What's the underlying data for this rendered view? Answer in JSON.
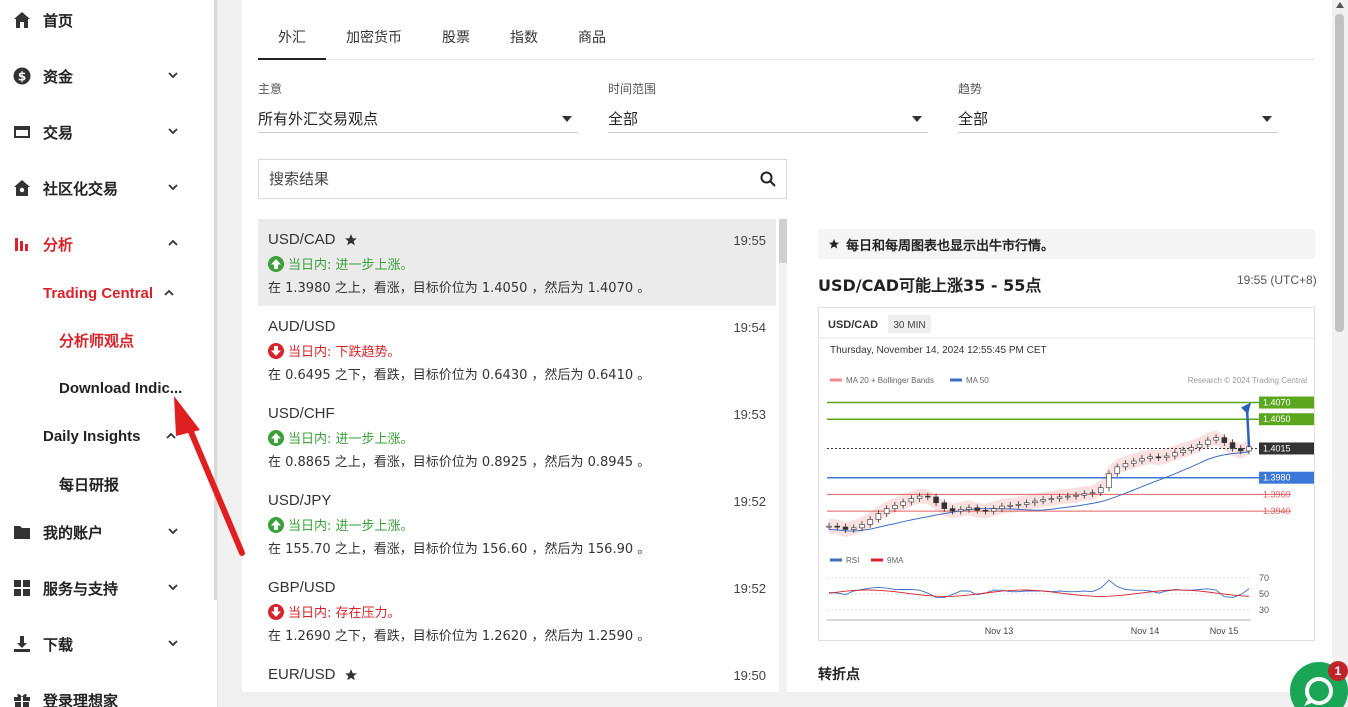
{
  "sidebar": {
    "items": [
      {
        "label": "首页",
        "icon": "home-icon"
      },
      {
        "label": "资金",
        "icon": "dollar-icon"
      },
      {
        "label": "交易",
        "icon": "card-icon"
      },
      {
        "label": "社区化交易",
        "icon": "community-icon"
      },
      {
        "label": "分析",
        "icon": "analysis-icon"
      },
      {
        "label": "我的账户",
        "icon": "folder-icon"
      },
      {
        "label": "服务与支持",
        "icon": "grid-icon"
      },
      {
        "label": "下载",
        "icon": "download-icon"
      },
      {
        "label": "登录理想家",
        "icon": "gift-icon"
      }
    ],
    "sub": {
      "trading_central": "Trading Central",
      "analyst_views": "分析师观点",
      "download_indicators": "Download Indic...",
      "daily_insights": "Daily Insights",
      "daily_report": "每日研报"
    }
  },
  "tabs": [
    "外汇",
    "加密货币",
    "股票",
    "指数",
    "商品"
  ],
  "filters": [
    {
      "label": "主意",
      "value": "所有外汇交易观点"
    },
    {
      "label": "时间范围",
      "value": "全部"
    },
    {
      "label": "趋势",
      "value": "全部"
    }
  ],
  "search": {
    "placeholder": "搜索结果"
  },
  "list": [
    {
      "pair": "USD/CAD",
      "starred": true,
      "time": "19:55",
      "direction": "up",
      "trend": "当日内: 进一步上涨。",
      "desc": "在 1.3980 之上，看涨，目标价位为 1.4050 ，然后为 1.4070 。"
    },
    {
      "pair": "AUD/USD",
      "starred": false,
      "time": "19:54",
      "direction": "down",
      "trend": "当日内: 下跌趋势。",
      "desc": "在 0.6495 之下，看跌，目标价位为 0.6430 ，然后为 0.6410 。"
    },
    {
      "pair": "USD/CHF",
      "starred": false,
      "time": "19:53",
      "direction": "up",
      "trend": "当日内: 进一步上涨。",
      "desc": "在 0.8865 之上，看涨，目标价位为 0.8925 ，然后为 0.8945 。"
    },
    {
      "pair": "USD/JPY",
      "starred": false,
      "time": "19:52",
      "direction": "up",
      "trend": "当日内: 进一步上涨。",
      "desc": "在 155.70 之上，看涨，目标价位为 156.60 ，然后为 156.90 。"
    },
    {
      "pair": "GBP/USD",
      "starred": false,
      "time": "19:52",
      "direction": "down",
      "trend": "当日内: 存在压力。",
      "desc": "在 1.2690 之下，看跌，目标价位为 1.2620 ，然后为 1.2590 。"
    },
    {
      "pair": "EUR/USD",
      "starred": true,
      "time": "19:50",
      "direction": "down",
      "trend": "",
      "desc": ""
    }
  ],
  "detail": {
    "banner": "每日和每周图表也显示出牛市行情。",
    "title": "USD/CAD可能上涨35 - 55点",
    "time": "19:55 (UTC+8)",
    "pivot_heading": "转折点"
  },
  "chart_data": {
    "type": "line",
    "symbol": "USD/CAD",
    "interval": "30 MIN",
    "timestamp": "Thursday, November 14, 2024 12:55:45 PM CET",
    "legend": [
      "MA 20 + Bollinger Bands",
      "MA 50"
    ],
    "credit": "Research © 2024 Trading Central",
    "levels": [
      {
        "value": "1.4070",
        "color": "#5aa61d"
      },
      {
        "value": "1.4050",
        "color": "#5aa61d"
      },
      {
        "value": "1.4015",
        "color": "#333333"
      },
      {
        "value": "1.3980",
        "color": "#3c78d8"
      },
      {
        "value": "1.3960",
        "color": "#e06060"
      },
      {
        "value": "1.3940",
        "color": "#e06060"
      }
    ],
    "ylim": [
      1.3915,
      1.4085
    ],
    "close": [
      1.3922,
      1.3921,
      1.3918,
      1.392,
      1.3924,
      1.393,
      1.3937,
      1.3943,
      1.3947,
      1.3951,
      1.3955,
      1.3958,
      1.3957,
      1.395,
      1.3943,
      1.394,
      1.3942,
      1.3944,
      1.3941,
      1.394,
      1.3943,
      1.3946,
      1.3947,
      1.3948,
      1.395,
      1.3952,
      1.3954,
      1.3955,
      1.3957,
      1.3958,
      1.3959,
      1.3961,
      1.3962,
      1.3968,
      1.3985,
      1.3993,
      1.3997,
      1.4,
      1.4003,
      1.4005,
      1.4004,
      1.4006,
      1.401,
      1.4013,
      1.4016,
      1.402,
      1.4025,
      1.4028,
      1.4022,
      1.4015,
      1.4012,
      1.4017
    ],
    "x_ticks": [
      "Nov 13",
      "Nov 14",
      "Nov 15"
    ],
    "rsi_legend": [
      "RSI",
      "9MA"
    ],
    "rsi_levels": [
      "70",
      "50",
      "30"
    ]
  },
  "chat": {
    "badge": "1"
  }
}
